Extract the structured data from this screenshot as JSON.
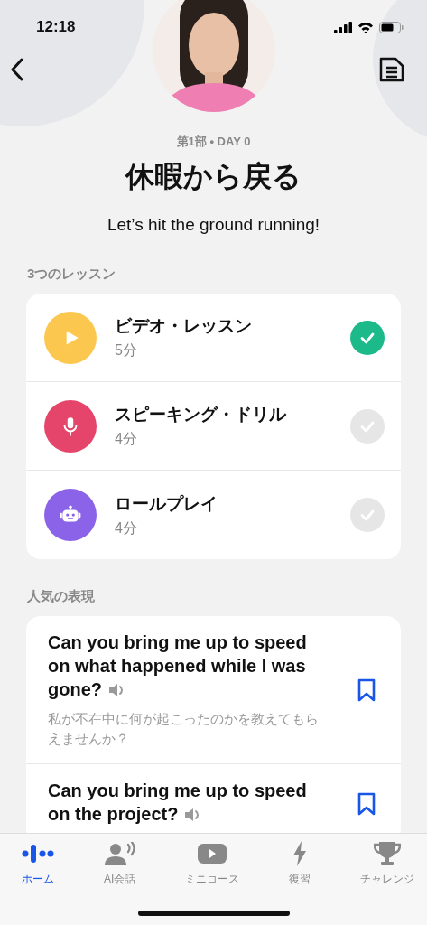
{
  "status_bar": {
    "time": "12:18"
  },
  "header": {
    "subtitle": "第1部 • DAY 0",
    "title": "休暇から戻る",
    "tagline": "Let’s hit the ground running!"
  },
  "lessons": {
    "section_title": "3つのレッスン",
    "items": [
      {
        "kind": "video",
        "title": "ビデオ・レッスン",
        "duration": "5分",
        "completed": true
      },
      {
        "kind": "speaking",
        "title": "スピーキング・ドリル",
        "duration": "4分",
        "completed": false
      },
      {
        "kind": "roleplay",
        "title": "ロールプレイ",
        "duration": "4分",
        "completed": false
      }
    ]
  },
  "phrases": {
    "section_title": "人気の表現",
    "items": [
      {
        "text": "Can you bring me up to speed on what happened while I was gone?",
        "translation": "私が不在中に何が起こったのかを教えてもらえませんか？"
      },
      {
        "text": "Can you bring me up to speed on the project?"
      }
    ]
  },
  "tabs": [
    {
      "kind": "home",
      "label": "ホーム",
      "selected": true
    },
    {
      "kind": "conversation",
      "label": "AI会話",
      "selected": false
    },
    {
      "kind": "course",
      "label": "ミニコース",
      "selected": false
    },
    {
      "kind": "review",
      "label": "復習",
      "selected": false
    },
    {
      "kind": "challenge",
      "label": "チャレンジ",
      "selected": false
    }
  ]
}
